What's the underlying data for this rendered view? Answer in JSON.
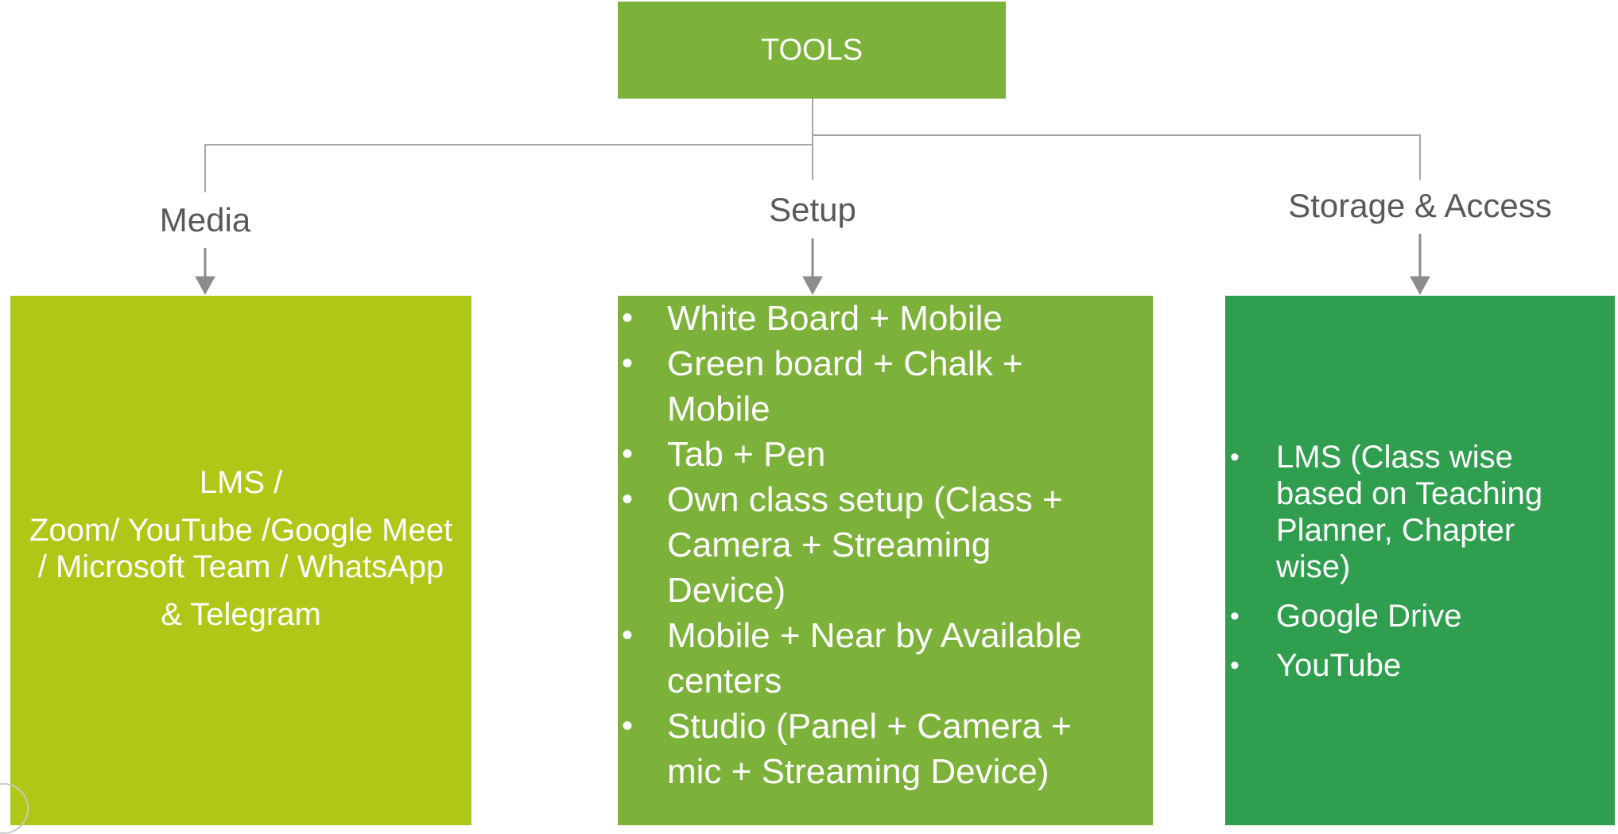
{
  "diagram": {
    "root": {
      "label": "TOOLS"
    },
    "branches": {
      "media": {
        "label": "Media",
        "box_lines": [
          "LMS /",
          "Zoom/ YouTube /Google Meet",
          "/ Microsoft Team / WhatsApp",
          "& Telegram"
        ]
      },
      "setup": {
        "label": "Setup",
        "items": [
          "White Board + Mobile",
          "Green board + Chalk + Mobile",
          "Tab + Pen",
          "Own class setup (Class + Camera + Streaming Device)",
          "Mobile + Near by Available centers",
          "Studio (Panel + Camera + mic + Streaming Device)"
        ]
      },
      "storage": {
        "label": "Storage & Access",
        "items": [
          "LMS (Class wise based on Teaching Planner, Chapter wise)",
          "Google Drive",
          "YouTube"
        ]
      }
    },
    "colors": {
      "root_fill": "#7cb13a",
      "media_fill": "#afc717",
      "setup_fill": "#7cb13a",
      "storage_fill": "#2f9e4f",
      "connector": "#a6a6a6",
      "arrow": "#8c8c8c",
      "label_text": "#595959"
    }
  }
}
